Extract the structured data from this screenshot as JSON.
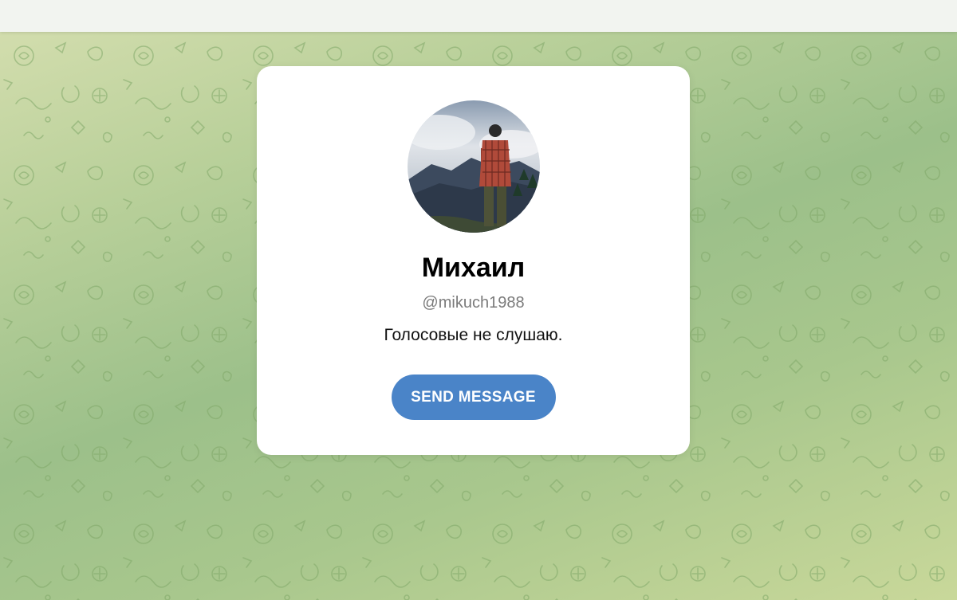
{
  "profile": {
    "name": "Михаил",
    "username": "@mikuch1988",
    "bio": "Голосовые не слушаю.",
    "avatar_icon": "profile-photo"
  },
  "actions": {
    "send_label": "SEND MESSAGE"
  },
  "colors": {
    "button": "#4a84c8",
    "card": "#ffffff",
    "background_start": "#d6dfb0",
    "background_end": "#9cc08a"
  }
}
